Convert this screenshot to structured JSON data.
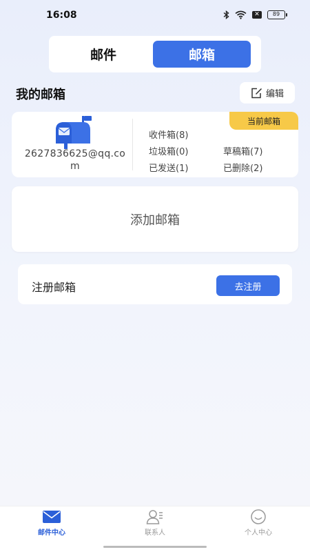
{
  "status_bar": {
    "time": "16:08",
    "battery": "89"
  },
  "tabs": [
    {
      "label": "邮件",
      "active": false
    },
    {
      "label": "邮箱",
      "active": true
    }
  ],
  "section": {
    "title": "我的邮箱",
    "edit_label": "编辑"
  },
  "current_mailbox": {
    "badge": "当前邮箱",
    "address": "2627836625@qq.com",
    "inbox": "收件箱(8)",
    "trash": "垃圾箱(0)",
    "drafts": "草稿箱(7)",
    "sent": "已发送(1)",
    "deleted": "已删除(2)"
  },
  "add_mailbox": {
    "label": "添加邮箱"
  },
  "register": {
    "label": "注册邮箱",
    "button": "去注册"
  },
  "bottom_nav": [
    {
      "label": "邮件中心",
      "icon": "mail-icon",
      "active": true
    },
    {
      "label": "联系人",
      "icon": "contacts-icon",
      "active": false
    },
    {
      "label": "个人中心",
      "icon": "smile-icon",
      "active": false
    }
  ],
  "colors": {
    "accent": "#3c71e6",
    "badge": "#f7c948",
    "background": "#eef2fb"
  }
}
